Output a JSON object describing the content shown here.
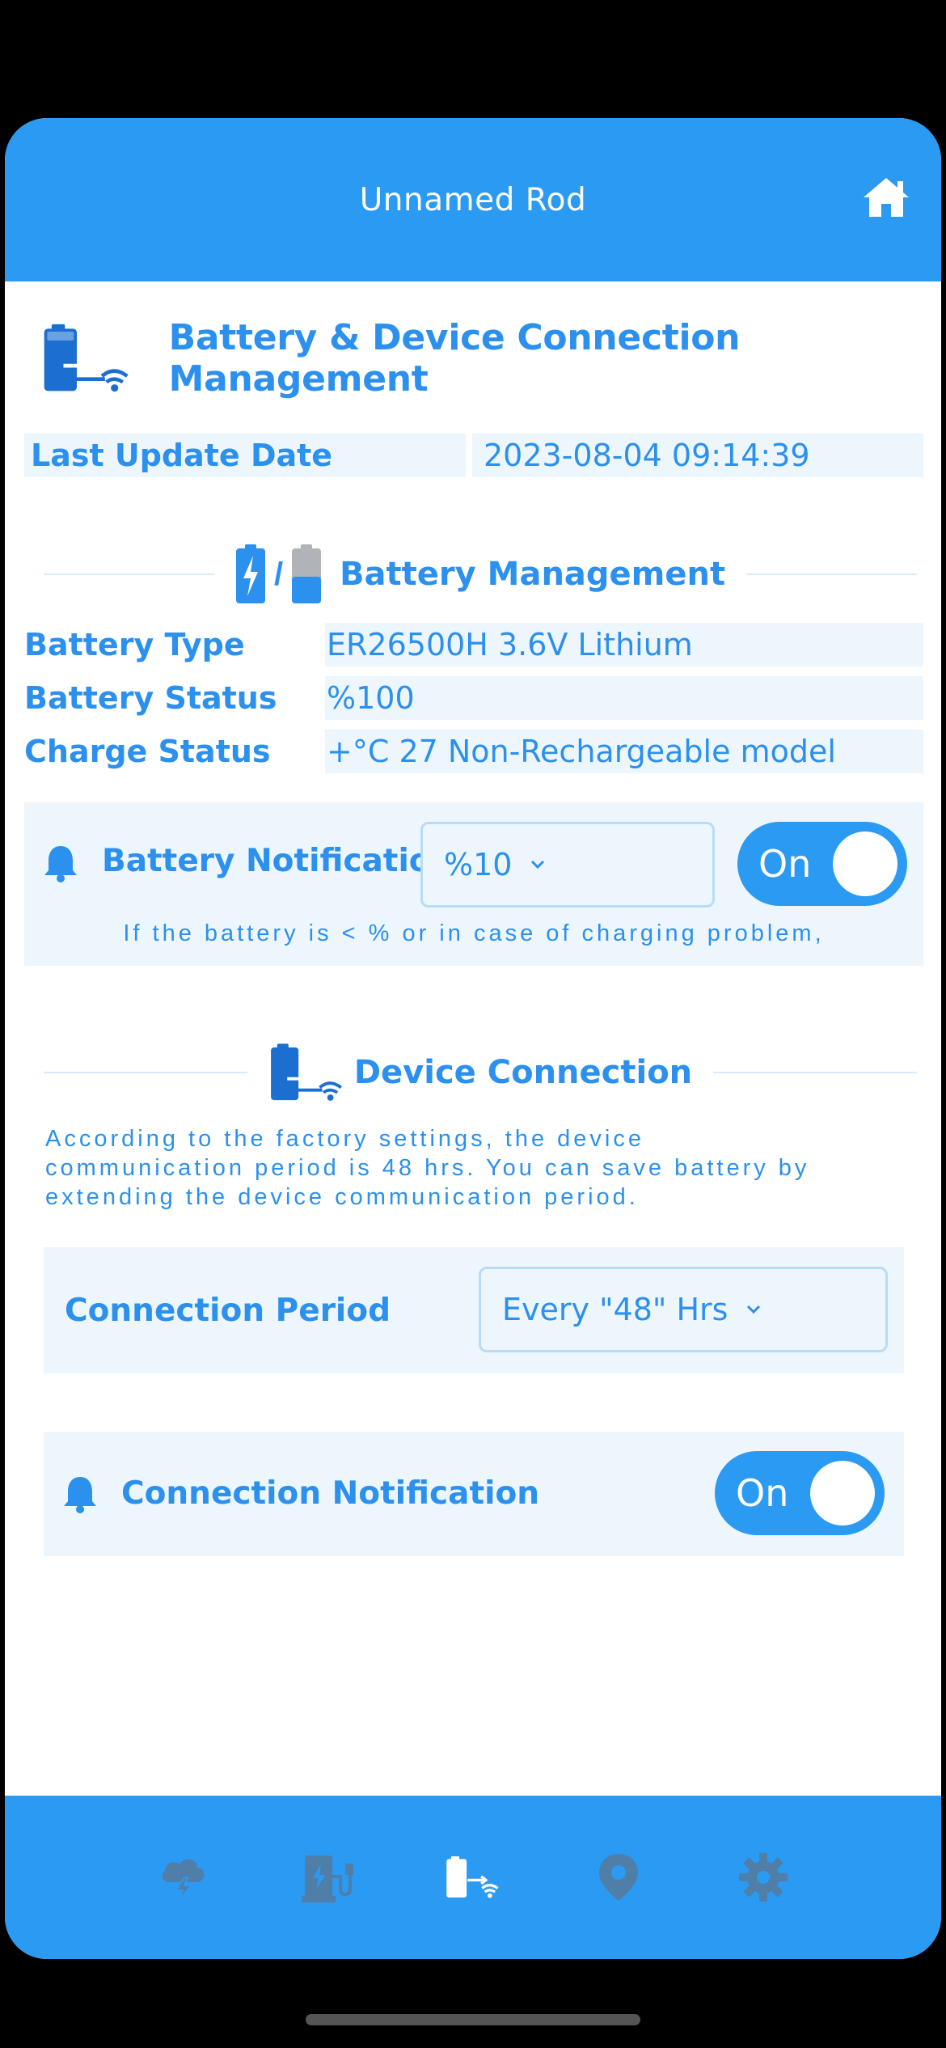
{
  "header": {
    "title": "Unnamed Rod"
  },
  "page": {
    "title": "Battery & Device Connection Management"
  },
  "last_update": {
    "label": "Last Update Date",
    "value": "2023-08-04 09:14:39"
  },
  "battery_section": {
    "title": "Battery Management",
    "separator": "/",
    "rows": [
      {
        "label": "Battery Type",
        "value": "ER26500H 3.6V Lithium"
      },
      {
        "label": "Battery Status",
        "value": "%100"
      },
      {
        "label": "Charge Status",
        "value": "+°C 27 Non-Rechargeable model"
      }
    ],
    "notification": {
      "label": "Battery Notification",
      "threshold": "%10",
      "toggle_label": "On",
      "hint": "If the battery is < % or in case of charging problem,"
    }
  },
  "device_section": {
    "title": "Device Connection",
    "description_lines": [
      "According to the factory settings, the device",
      "communication period is 48 hrs. You can save battery by",
      "extending the device communication period."
    ],
    "period": {
      "label": "Connection Period",
      "value": "Every \"48\" Hrs"
    },
    "notification": {
      "label": "Connection Notification",
      "toggle_label": "On"
    }
  },
  "colors": {
    "primary": "#2b9af3",
    "text": "#2b90ee",
    "panel": "#eef6fd",
    "nav_icon": "#4f7ea8",
    "nav_icon_active": "#ffffff"
  },
  "nav": {
    "items": [
      "weather-icon",
      "charging-icon",
      "battery-connection-icon",
      "location-icon",
      "settings-icon"
    ],
    "active": "battery-connection-icon"
  }
}
